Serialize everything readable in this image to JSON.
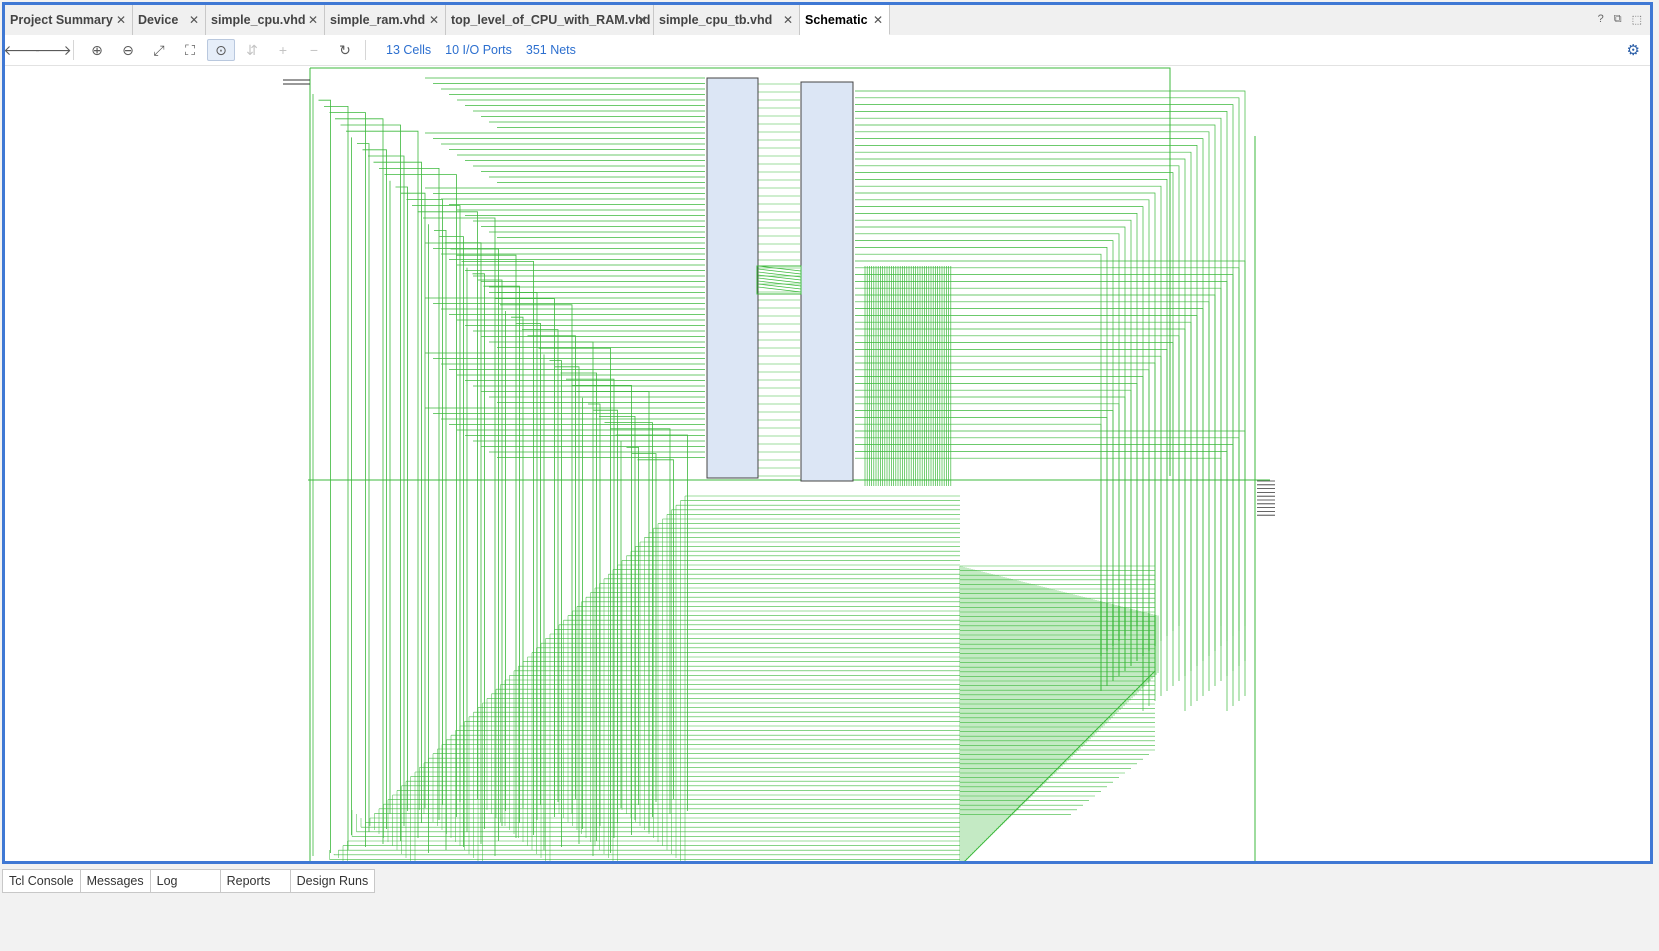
{
  "tabs": [
    {
      "label": "Project Summary",
      "active": false
    },
    {
      "label": "Device",
      "active": false
    },
    {
      "label": "simple_cpu.vhd",
      "active": false
    },
    {
      "label": "simple_ram.vhd",
      "active": false
    },
    {
      "label": "top_level_of_CPU_with_RAM.vhd",
      "active": false
    },
    {
      "label": "simple_cpu_tb.vhd",
      "active": false
    },
    {
      "label": "Schematic",
      "active": true
    }
  ],
  "window_controls": {
    "help": "?",
    "restore": "⧉",
    "maximize": "⬚"
  },
  "toolbar": {
    "buttons": [
      {
        "name": "back-arrow-icon",
        "glyph": "🡐",
        "enabled": true
      },
      {
        "name": "forward-arrow-icon",
        "glyph": "🡒",
        "enabled": true
      },
      {
        "name": "zoom-in-icon",
        "glyph": "⊕",
        "enabled": true
      },
      {
        "name": "zoom-out-icon",
        "glyph": "⊖",
        "enabled": true
      },
      {
        "name": "zoom-fit-icon",
        "glyph": "⤢",
        "enabled": true
      },
      {
        "name": "zoom-selection-icon",
        "glyph": "⛶",
        "enabled": true
      },
      {
        "name": "select-mode-icon",
        "glyph": "⊙",
        "enabled": true
      },
      {
        "name": "regenerate-icon",
        "glyph": "⇵",
        "enabled": false
      },
      {
        "name": "expand-icon",
        "glyph": "+",
        "enabled": false
      },
      {
        "name": "collapse-icon",
        "glyph": "−",
        "enabled": false
      },
      {
        "name": "refresh-icon",
        "glyph": "↻",
        "enabled": true
      }
    ],
    "cells": "13 Cells",
    "io_ports": "10 I/O Ports",
    "nets": "351 Nets",
    "settings_icon": "gear-icon"
  },
  "bottom_tabs": [
    "Tcl Console",
    "Messages",
    "Log",
    "Reports",
    "Design Runs"
  ],
  "colors": {
    "frame": "#3f78d4",
    "net": "#3cb93c",
    "cell_fill": "#dce6f5",
    "cell_stroke": "#444444"
  }
}
